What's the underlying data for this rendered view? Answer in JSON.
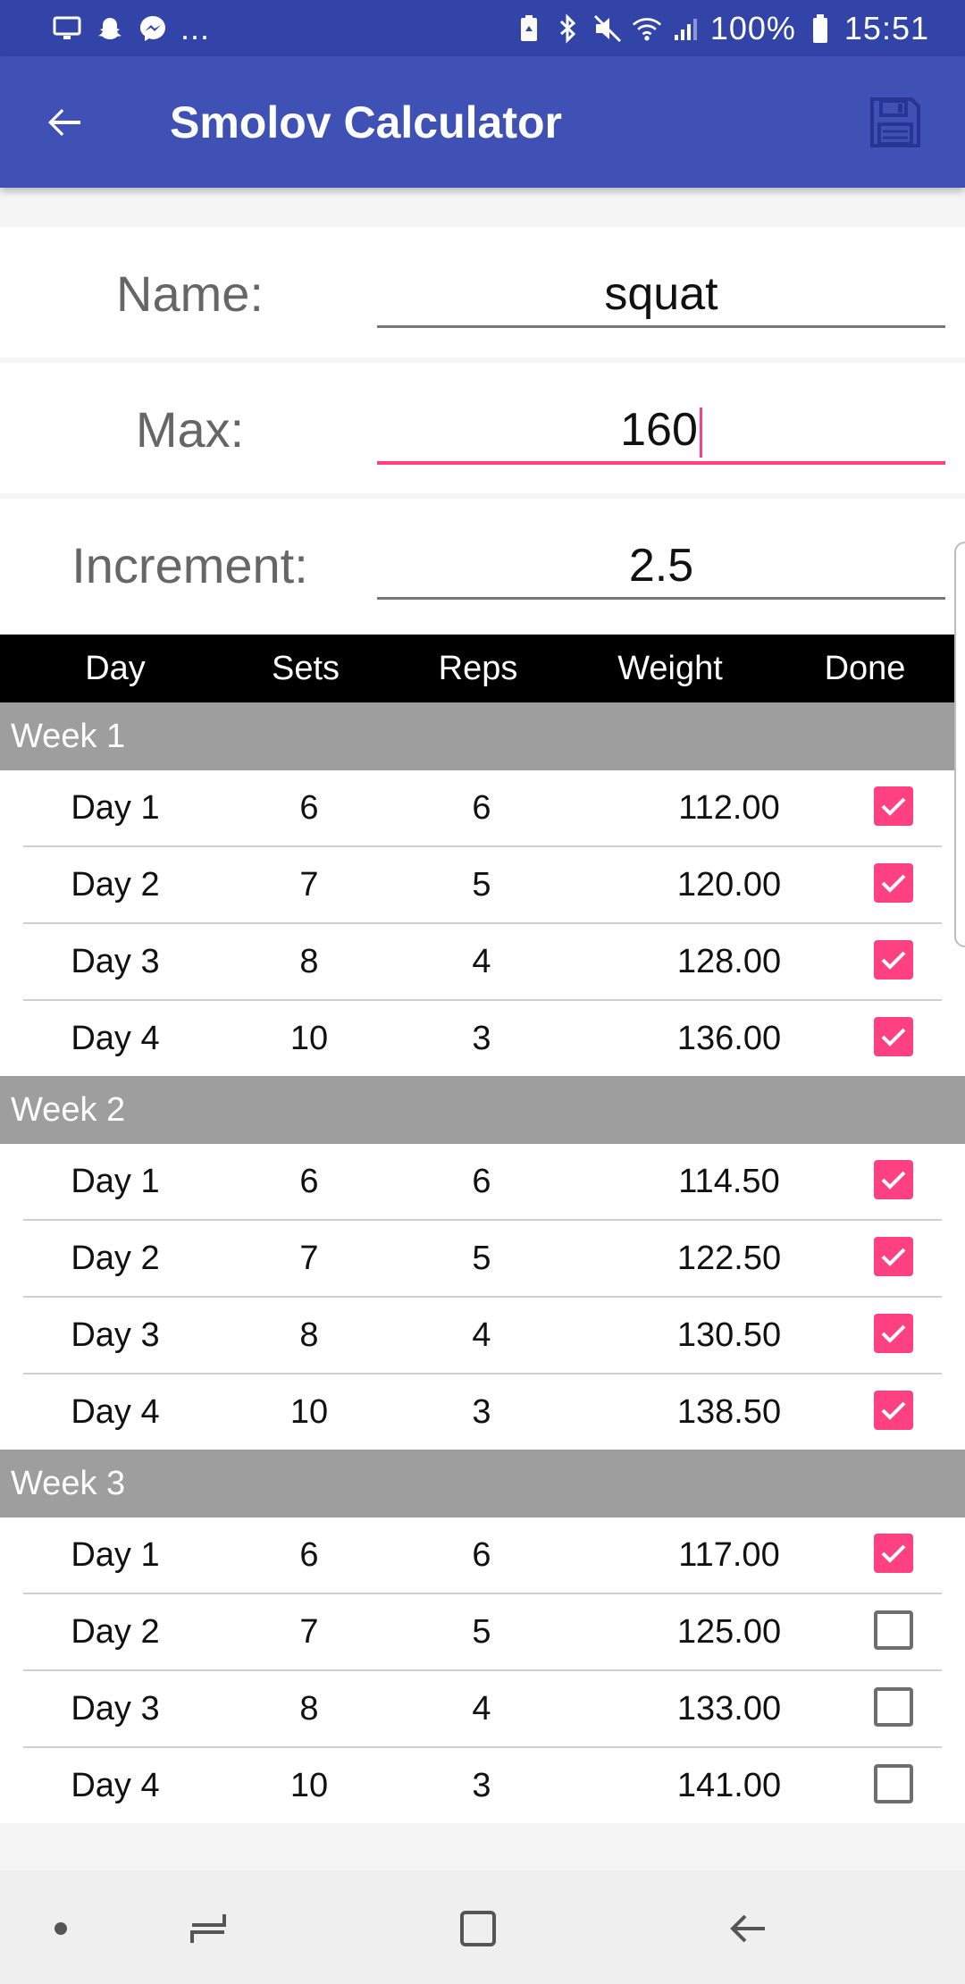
{
  "status_bar": {
    "left_icons": [
      "screen-mirror-icon",
      "snapchat-icon",
      "messenger-icon"
    ],
    "more": "...",
    "right_icons": [
      "battery-saver-icon",
      "bluetooth-icon",
      "mute-icon",
      "wifi-icon",
      "signal-icon"
    ],
    "battery": "100%",
    "time": "15:51"
  },
  "app_bar": {
    "title": "Smolov Calculator",
    "back_icon": "arrow-back-icon",
    "save_icon": "floppy-save-icon"
  },
  "form": {
    "name_label": "Name:",
    "name_value": "squat",
    "max_label": "Max:",
    "max_value": "160",
    "increment_label": "Increment:",
    "increment_value": "2.5"
  },
  "table": {
    "headers": [
      "Day",
      "Sets",
      "Reps",
      "Weight",
      "Done"
    ],
    "weeks": [
      {
        "label": "Week 1",
        "rows": [
          {
            "day": "Day 1",
            "sets": "6",
            "reps": "6",
            "weight": "112.00",
            "done": true
          },
          {
            "day": "Day 2",
            "sets": "7",
            "reps": "5",
            "weight": "120.00",
            "done": true
          },
          {
            "day": "Day 3",
            "sets": "8",
            "reps": "4",
            "weight": "128.00",
            "done": true
          },
          {
            "day": "Day 4",
            "sets": "10",
            "reps": "3",
            "weight": "136.00",
            "done": true
          }
        ]
      },
      {
        "label": "Week 2",
        "rows": [
          {
            "day": "Day 1",
            "sets": "6",
            "reps": "6",
            "weight": "114.50",
            "done": true
          },
          {
            "day": "Day 2",
            "sets": "7",
            "reps": "5",
            "weight": "122.50",
            "done": true
          },
          {
            "day": "Day 3",
            "sets": "8",
            "reps": "4",
            "weight": "130.50",
            "done": true
          },
          {
            "day": "Day 4",
            "sets": "10",
            "reps": "3",
            "weight": "138.50",
            "done": true
          }
        ]
      },
      {
        "label": "Week 3",
        "rows": [
          {
            "day": "Day 1",
            "sets": "6",
            "reps": "6",
            "weight": "117.00",
            "done": true
          },
          {
            "day": "Day 2",
            "sets": "7",
            "reps": "5",
            "weight": "125.00",
            "done": false
          },
          {
            "day": "Day 3",
            "sets": "8",
            "reps": "4",
            "weight": "133.00",
            "done": false
          },
          {
            "day": "Day 4",
            "sets": "10",
            "reps": "3",
            "weight": "141.00",
            "done": false
          }
        ]
      }
    ]
  },
  "nav_bar": {
    "icons": [
      "dot-icon",
      "recent-apps-icon",
      "home-icon",
      "back-icon"
    ]
  },
  "colors": {
    "status_bar": "#3344a8",
    "app_bar": "#3f51b5",
    "accent": "#ff4081",
    "week_header": "#9e9e9e",
    "table_header": "#000000"
  }
}
